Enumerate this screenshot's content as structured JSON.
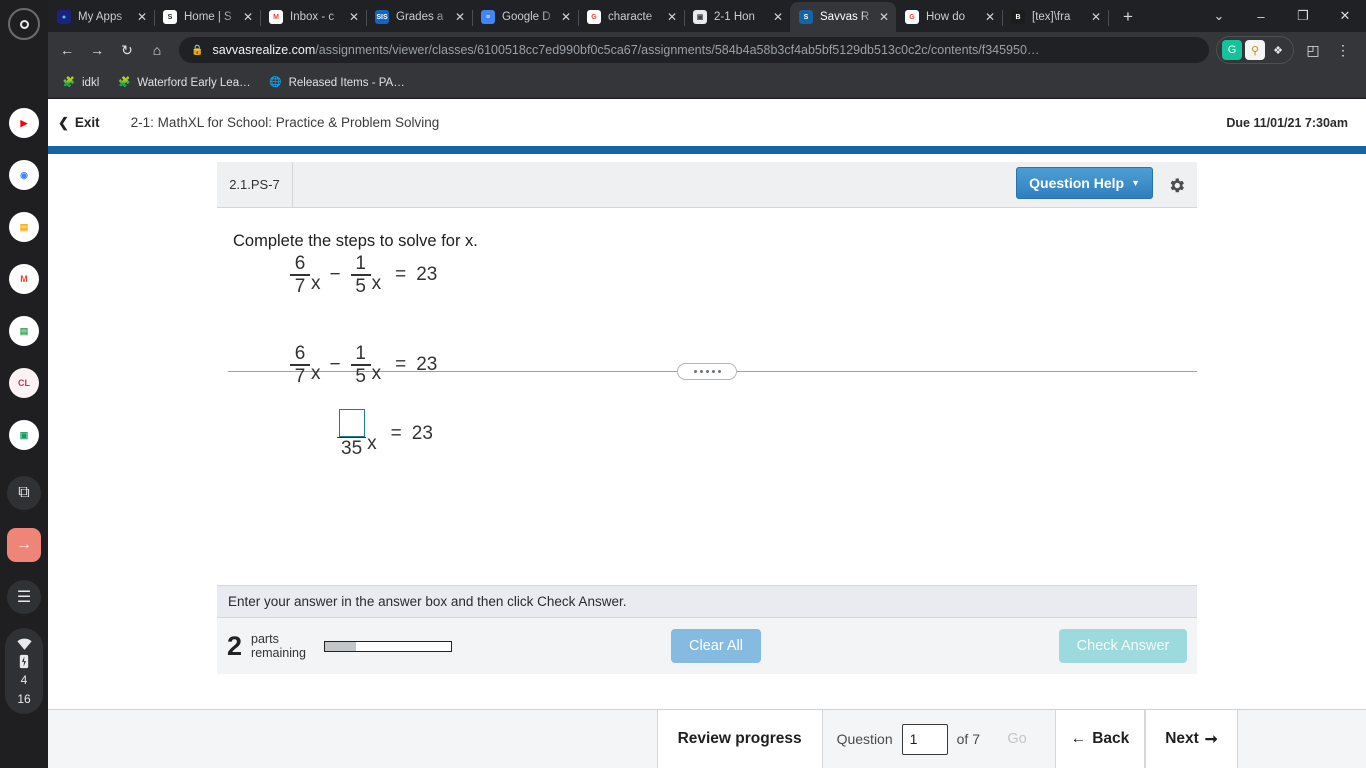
{
  "shelf": {
    "launcher": "launcher-icon",
    "apps": [
      {
        "name": "youtube",
        "glyph": "▶",
        "bg": "#ffffff",
        "fg": "#ff0000",
        "active": false
      },
      {
        "name": "chrome",
        "glyph": "◉",
        "bg": "#ffffff",
        "fg": "#4285f4",
        "active": true
      },
      {
        "name": "google-slides",
        "glyph": "▤",
        "bg": "#ffffff",
        "fg": "#f9ab00",
        "active": false
      },
      {
        "name": "gmail",
        "glyph": "M",
        "bg": "#ffffff",
        "fg": "#ea4335",
        "active": true
      },
      {
        "name": "google-classroom-docs",
        "glyph": "▤",
        "bg": "#ffffff",
        "fg": "#34a853",
        "active": false
      },
      {
        "name": "cl-app",
        "glyph": "CL",
        "bg": "#fdf2f4",
        "fg": "#c5334f",
        "active": false
      },
      {
        "name": "google-classroom",
        "glyph": "▣",
        "bg": "#ffffff",
        "fg": "#0f9d58",
        "active": true
      }
    ],
    "system": [
      {
        "name": "screen-capture-icon",
        "glyph": "⧉"
      },
      {
        "name": "sign-in-icon",
        "glyph": "→",
        "accent": true
      },
      {
        "name": "media-playlist-icon",
        "glyph": "☰"
      }
    ],
    "status": {
      "wifi_icon": "wifi-icon",
      "battery_icon": "battery-charging-icon",
      "time_hour": "4",
      "time_minute": "16"
    }
  },
  "browser": {
    "tabs": [
      {
        "title": "My Apps",
        "favicon": "myapps-icon",
        "fav_bg": "#1a237e",
        "fav_fg": "#4fc3f7",
        "fav_glyph": "●",
        "active": false
      },
      {
        "title": "Home | S",
        "favicon": "schoology-icon",
        "fav_bg": "#ffffff",
        "fav_fg": "#1c1c1c",
        "fav_glyph": "S",
        "active": false
      },
      {
        "title": "Inbox - c",
        "favicon": "gmail-icon",
        "fav_bg": "#ffffff",
        "fav_fg": "#ea4335",
        "fav_glyph": "M",
        "active": false
      },
      {
        "title": "Grades a",
        "favicon": "sis-icon",
        "fav_bg": "#1565c0",
        "fav_fg": "#ffffff",
        "fav_glyph": "SIS",
        "active": false
      },
      {
        "title": "Google D",
        "favicon": "google-docs-icon",
        "fav_bg": "#4285f4",
        "fav_fg": "#ffffff",
        "fav_glyph": "≡",
        "active": false
      },
      {
        "title": "characte",
        "favicon": "google-icon",
        "fav_bg": "#ffffff",
        "fav_fg": "#ea4335",
        "fav_glyph": "G",
        "active": false
      },
      {
        "title": "2-1 Hon",
        "favicon": "image-icon",
        "fav_bg": "#e8eaed",
        "fav_fg": "#3c4043",
        "fav_glyph": "▣",
        "active": false
      },
      {
        "title": "Savvas R",
        "favicon": "savvas-icon",
        "fav_bg": "#1565a5",
        "fav_fg": "#ffffff",
        "fav_glyph": "S",
        "active": true
      },
      {
        "title": "How do",
        "favicon": "google-icon",
        "fav_bg": "#ffffff",
        "fav_fg": "#ea4335",
        "fav_glyph": "G",
        "active": false
      },
      {
        "title": "[tex]\\fra",
        "favicon": "brainly-icon",
        "fav_bg": "#1c1c1c",
        "fav_fg": "#ffffff",
        "fav_glyph": "B",
        "active": false
      }
    ],
    "new_tab_label": "+",
    "window_controls": [
      {
        "name": "tab-search-button",
        "glyph": "⌄"
      },
      {
        "name": "minimize-button",
        "glyph": "–"
      },
      {
        "name": "maximize-restore-button",
        "glyph": "❐"
      },
      {
        "name": "close-window-button",
        "glyph": "✕"
      }
    ],
    "toolbar": {
      "back_glyph": "←",
      "forward_glyph": "→",
      "reload_glyph": "↻",
      "home_glyph": "⌂",
      "menu_glyph": "⋮",
      "cast_glyph": "◰"
    },
    "omnibox": {
      "lock_icon": "lock-icon",
      "host": "savvasrealize.com",
      "path": "/assignments/viewer/classes/6100518cc7ed990bf0c5ca67/assignments/584b4a58b3cf4ab5bf5129db513c0c2c/contents/f345950…"
    },
    "extensions": [
      {
        "name": "grammarly-extension-icon",
        "glyph": "G",
        "bg": "#15c39a",
        "fg": "#ffffff"
      },
      {
        "name": "password-extension-icon",
        "glyph": "⚲",
        "bg": "#f5f5f5",
        "fg": "#c28e0e"
      },
      {
        "name": "extensions-puzzle-icon",
        "glyph": "❖",
        "bg": "transparent",
        "fg": "#e8eaed"
      }
    ],
    "bookmarks": [
      {
        "label": "idkl",
        "icon": "folder-app-icon"
      },
      {
        "label": "Waterford Early Lea…",
        "icon": "folder-app-icon"
      },
      {
        "label": "Released Items - PA…",
        "icon": "globe-icon"
      }
    ]
  },
  "assignment": {
    "exit_label": "Exit",
    "exit_icon": "chevron-left-icon",
    "title": "2-1: MathXL for School: Practice & Problem Solving",
    "due": "Due 11/01/21 7:30am"
  },
  "question": {
    "id": "2.1.PS-7",
    "help_label": "Question Help",
    "help_caret": "▼",
    "gear_icon": "gear-icon",
    "prompt": "Complete the steps to solve for x.",
    "equation_1": {
      "frac_a_num": "6",
      "frac_a_den": "7",
      "var_a": "x",
      "operator": "−",
      "frac_b_num": "1",
      "frac_b_den": "5",
      "var_b": "x",
      "equals": "=",
      "rhs": "23"
    },
    "equation_2": {
      "frac_a_num": "6",
      "frac_a_den": "7",
      "var_a": "x",
      "operator": "−",
      "frac_b_num": "1",
      "frac_b_den": "5",
      "var_b": "x",
      "equals": "=",
      "rhs": "23"
    },
    "equation_3": {
      "answer_value": "",
      "answer_placeholder": "",
      "frac_den": "35",
      "var": "x",
      "equals": "=",
      "rhs": "23"
    },
    "instruction": "Enter your answer in the answer box and then click Check Answer.",
    "parts_count": "2",
    "parts_label_line1": "parts",
    "parts_label_line2": "remaining",
    "progress_percent": 25,
    "clear_all_label": "Clear All",
    "check_answer_label": "Check Answer"
  },
  "bottom_nav": {
    "review_label": "Review progress",
    "question_label": "Question",
    "question_value": "1",
    "of_label": "of 7",
    "go_label": "Go",
    "back_label": "Back",
    "back_icon": "arrow-left-icon",
    "next_label": "Next",
    "next_icon": "arrow-right-icon"
  },
  "colors": {
    "brand_blue": "#1565a5",
    "help_button": "#2f7fc0",
    "answer_box_border": "#1f7a8c",
    "clear_all": "#85bbe0",
    "check_answer": "#9ddade"
  }
}
